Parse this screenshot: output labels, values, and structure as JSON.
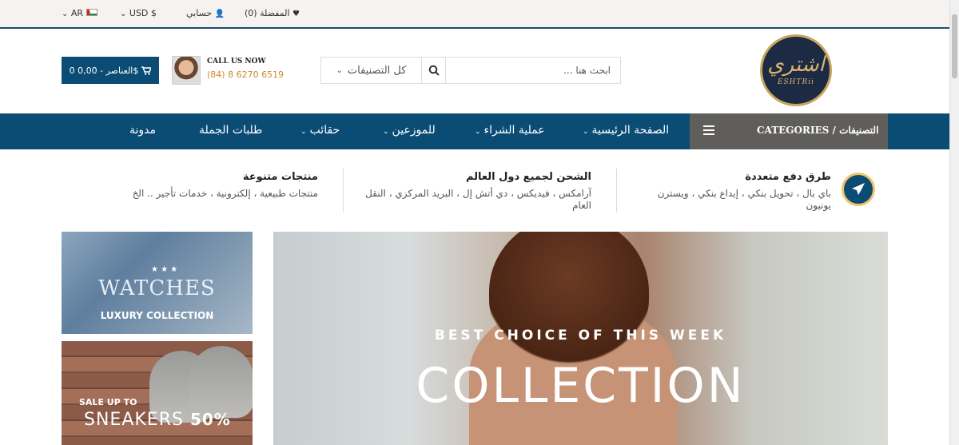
{
  "topbar": {
    "wishlist": "المفضلة (0)",
    "account": "حسابي",
    "currency": "USD $",
    "language": "AR"
  },
  "header": {
    "logo_ar": "اشتري",
    "logo_en": "ESHTRii",
    "search_placeholder": "ابحث هنا ...",
    "search_category": "كل التصنيفات",
    "call_label": "CALL US NOW",
    "call_number": "(84) 8 6270 6519",
    "cart": "0 العناصر - 0,00$"
  },
  "nav": {
    "categories": "CATEGORIES / التصنيفات",
    "items": [
      "الصفحة الرئيسية",
      "عملية الشراء",
      "للموزعين",
      "حقائب",
      "طلبات الجملة",
      "مدونة"
    ]
  },
  "features": [
    {
      "title": "طرق دفع متعددة",
      "desc": "باي بال ، تحويل بنكي ، إيداع بنكي ، ويسترن يونيون"
    },
    {
      "title": "الشحن لجميع دول العالم",
      "desc": "آرامكس ، فيديكس ، دي أتش إل ، البريد المركزي ، النقل العام"
    },
    {
      "title": "منتجات متنوعة",
      "desc": "منتجات طبيعية ، إلكترونية ، خدمات تأجير .. الخ"
    }
  ],
  "banners": {
    "watches_title": "WATCHES",
    "watches_sub": "LUXURY COLLECTION",
    "sneakers_sale": "SALE UP TO",
    "sneakers_title": "SNEAKERS",
    "sneakers_pct": "50%",
    "hero_kicker": "BEST CHOICE OF THIS WEEK",
    "hero_title": "COLLECTION"
  },
  "icons": [
    "heart-icon",
    "user-icon",
    "flag-icon",
    "search-icon",
    "cart-icon",
    "menu-icon",
    "paper-plane-icon"
  ]
}
